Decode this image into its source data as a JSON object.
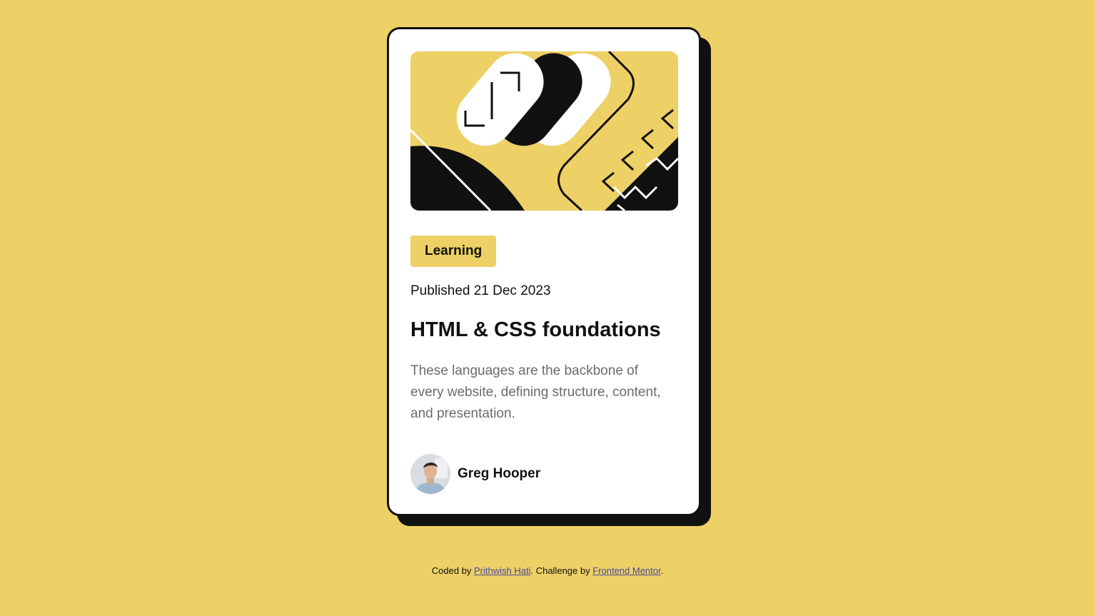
{
  "card": {
    "category": "Learning",
    "published": "Published 21 Dec 2023",
    "title": "HTML & CSS foundations",
    "description": "These languages are the backbone of every website, defining structure, content, and presentation.",
    "author": {
      "name": "Greg Hooper"
    },
    "illustration_icon": "abstract-illustration-icon",
    "avatar_icon": "avatar-icon"
  },
  "footer": {
    "prefix": "Coded by ",
    "author_link": "Prithwish Hati",
    "middle": ". Challenge by ",
    "challenge_link": "Frontend Mentor",
    "suffix": "."
  },
  "colors": {
    "background": "#edd066",
    "card": "#ffffff",
    "ink": "#111111",
    "muted_text": "#6b6b6b",
    "link": "#4a4a9c"
  }
}
